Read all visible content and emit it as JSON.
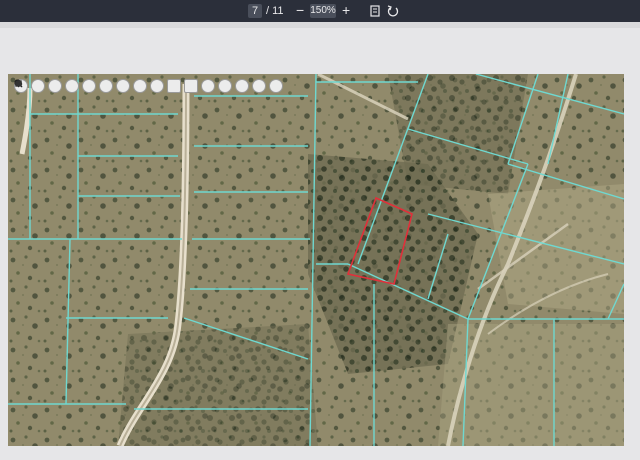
{
  "viewer": {
    "current_page": "7",
    "total_pages": "/ 11",
    "zoom_out": "−",
    "zoom_level": "150%",
    "zoom_in": "+"
  },
  "toolbar_icons": [
    "zoom-in-icon",
    "zoom-out-icon",
    "pan-icon",
    "arrow-left-icon",
    "arrow-right-icon",
    "search-icon",
    "globe-icon",
    "close-icon",
    "measure-icon",
    "print-icon",
    "bookmark-icon",
    "layers-icon",
    "folder-icon",
    "help-icon",
    "info-icon",
    "settings-icon"
  ],
  "colors": {
    "parcel_line": "#6fd8d0",
    "highlight_parcel": "#e0303a",
    "road": "#e7dfcc"
  }
}
